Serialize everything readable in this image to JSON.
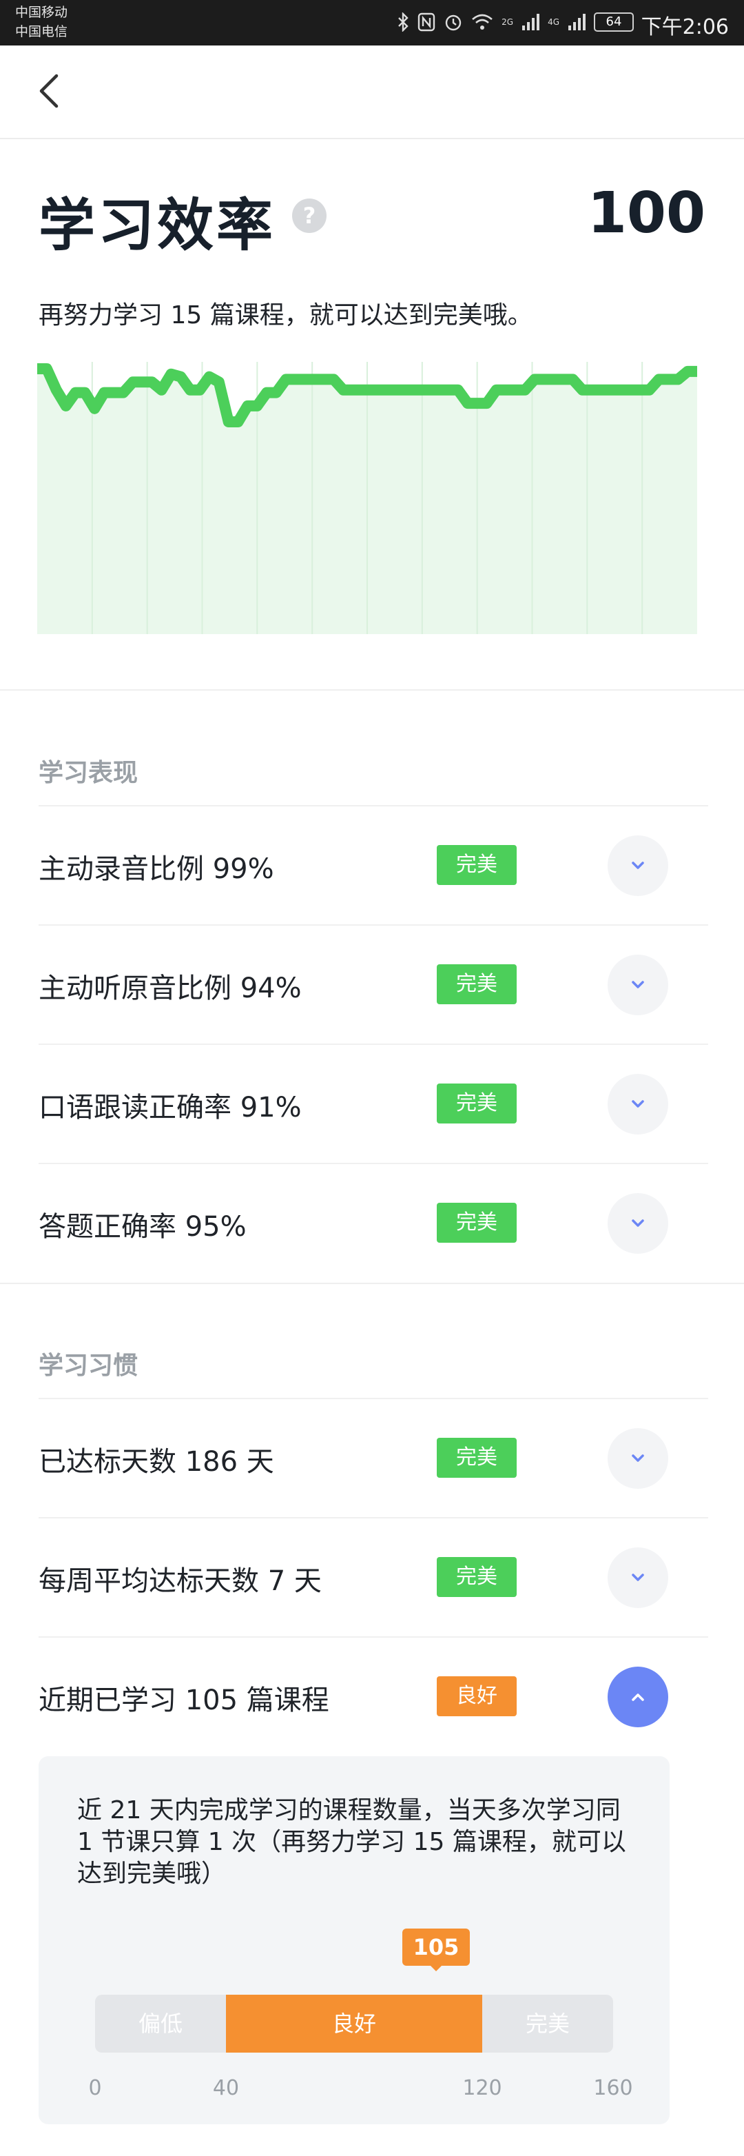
{
  "status_bar": {
    "carrier1": "中国移动",
    "carrier2": "中国电信",
    "signal_2g": "2G",
    "signal_4g": "4G",
    "battery": "64",
    "time": "下午2:06"
  },
  "header": {
    "title": "学习效率",
    "help": "?",
    "score": "100",
    "subtitle": "再努力学习 15 篇课程，就可以达到完美哦。"
  },
  "chart_data": {
    "type": "area",
    "title": "",
    "xlabel": "",
    "ylabel": "",
    "grid": true,
    "ylim": [
      0,
      100
    ],
    "color": "#4ccf5a",
    "fill": "#eaf8ec",
    "values": [
      100,
      100,
      92,
      86,
      91,
      91,
      85,
      91,
      91,
      91,
      95,
      95,
      95,
      92,
      98,
      97,
      92,
      92,
      97,
      95,
      80,
      80,
      86,
      86,
      91,
      91,
      96,
      96,
      96,
      96,
      96,
      96,
      92,
      92,
      92,
      92,
      92,
      92,
      92,
      92,
      92,
      92,
      92,
      92,
      92,
      87,
      87,
      87,
      92,
      92,
      92,
      92,
      96,
      96,
      96,
      96,
      96,
      92,
      92,
      92,
      92,
      92,
      92,
      92,
      92,
      96,
      96,
      96,
      99,
      99
    ]
  },
  "performance": {
    "title": "学习表现",
    "items": [
      {
        "label": "主动录音比例 99%",
        "badge": "完美"
      },
      {
        "label": "主动听原音比例 94%",
        "badge": "完美"
      },
      {
        "label": "口语跟读正确率 91%",
        "badge": "完美"
      },
      {
        "label": "答题正确率 95%",
        "badge": "完美"
      }
    ]
  },
  "habits": {
    "title": "学习习惯",
    "items": [
      {
        "label": "已达标天数 186 天",
        "badge": "完美"
      },
      {
        "label": "每周平均达标天数 7 天",
        "badge": "完美"
      },
      {
        "label": "近期已学习 105 篇课程",
        "badge": "良好"
      }
    ]
  },
  "detail": {
    "text": "近 21 天内完成学习的课程数量，当天多次学习同 1 节课只算 1 次（再努力学习 15 篇课程，就可以达到完美哦）",
    "marker_value": "105",
    "seg_low": "偏低",
    "seg_good": "良好",
    "seg_perfect": "完美",
    "ticks": [
      "0",
      "40",
      "120",
      "160"
    ]
  },
  "colors": {
    "green": "#4ccf5a",
    "orange": "#f59031",
    "accent_blue": "#6b86f5"
  }
}
